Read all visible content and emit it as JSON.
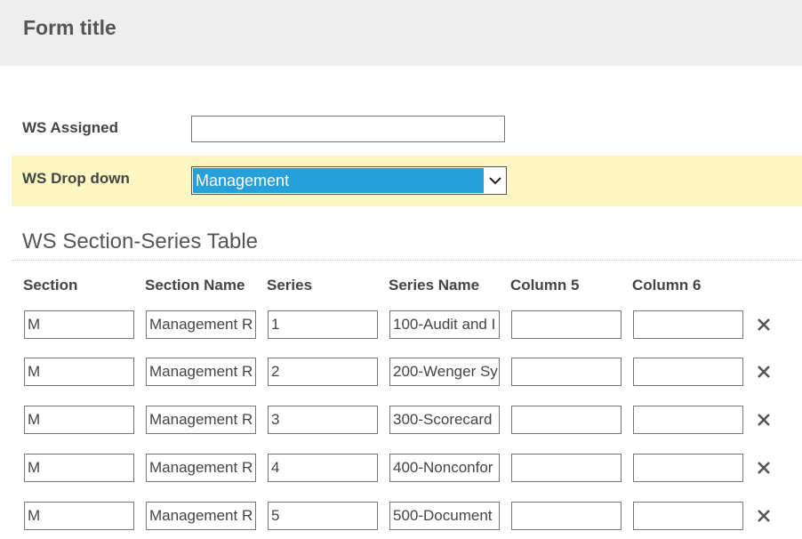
{
  "form": {
    "title": "Form title"
  },
  "fields": {
    "ws_assigned": {
      "label": "WS Assigned",
      "value": ""
    },
    "ws_dropdown": {
      "label": "WS Drop down",
      "value": "Management"
    }
  },
  "table": {
    "title": "WS Section-Series Table",
    "columns": [
      "Section",
      "Section Name",
      "Series",
      "Series Name",
      "Column 5",
      "Column 6"
    ],
    "rows": [
      {
        "section": "M",
        "section_name": "Management R",
        "series": "1",
        "series_name": "100-Audit and I",
        "col5": "",
        "col6": ""
      },
      {
        "section": "M",
        "section_name": "Management R",
        "series": "2",
        "series_name": "200-Wenger Sy",
        "col5": "",
        "col6": ""
      },
      {
        "section": "M",
        "section_name": "Management R",
        "series": "3",
        "series_name": "300-Scorecard",
        "col5": "",
        "col6": ""
      },
      {
        "section": "M",
        "section_name": "Management R",
        "series": "4",
        "series_name": "400-Nonconfor",
        "col5": "",
        "col6": ""
      },
      {
        "section": "M",
        "section_name": "Management R",
        "series": "5",
        "series_name": "500-Document",
        "col5": "",
        "col6": ""
      }
    ]
  },
  "icons": {
    "delete": "close-icon",
    "dropdown": "chevron-down-icon"
  },
  "colors": {
    "highlight_row": "#fdf7c3",
    "selected": "#26a0da",
    "header_bg": "#eeeeee"
  }
}
